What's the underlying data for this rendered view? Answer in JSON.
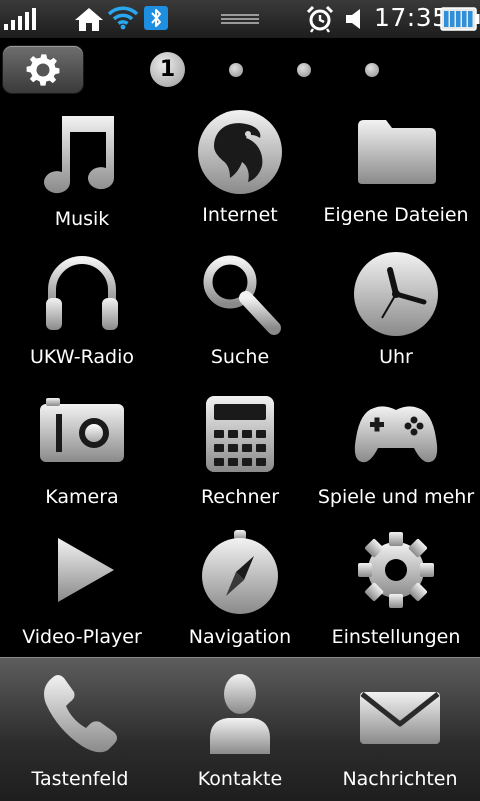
{
  "status_bar": {
    "time": "17:35",
    "icons": [
      "signal-strength-icon",
      "home-icon",
      "wifi-icon",
      "bluetooth-icon",
      "notification-handle",
      "alarm-icon",
      "volume-icon",
      "battery-icon"
    ]
  },
  "page_indicator": {
    "current": "1",
    "total_pages": 4
  },
  "apps": [
    {
      "label": "Musik",
      "icon": "music-note-icon"
    },
    {
      "label": "Internet",
      "icon": "globe-browser-icon"
    },
    {
      "label": "Eigene Dateien",
      "icon": "folder-icon"
    },
    {
      "label": "UKW-Radio",
      "icon": "headphones-icon"
    },
    {
      "label": "Suche",
      "icon": "magnifier-icon"
    },
    {
      "label": "Uhr",
      "icon": "clock-icon"
    },
    {
      "label": "Kamera",
      "icon": "camera-icon"
    },
    {
      "label": "Rechner",
      "icon": "calculator-icon"
    },
    {
      "label": "Spiele und mehr",
      "icon": "gamepad-icon"
    },
    {
      "label": "Video-Player",
      "icon": "play-icon"
    },
    {
      "label": "Navigation",
      "icon": "compass-icon"
    },
    {
      "label": "Einstellungen",
      "icon": "gear-icon"
    }
  ],
  "dock": [
    {
      "label": "Tastenfeld",
      "icon": "phone-icon"
    },
    {
      "label": "Kontakte",
      "icon": "contact-icon"
    },
    {
      "label": "Nachrichten",
      "icon": "envelope-icon"
    }
  ],
  "colors": {
    "background": "#000000",
    "icon_gradient_light": "#f2f2f2",
    "icon_gradient_dark": "#8a8a8a",
    "bluetooth": "#1e8fe0",
    "battery_fill": "#2f8fd8"
  }
}
